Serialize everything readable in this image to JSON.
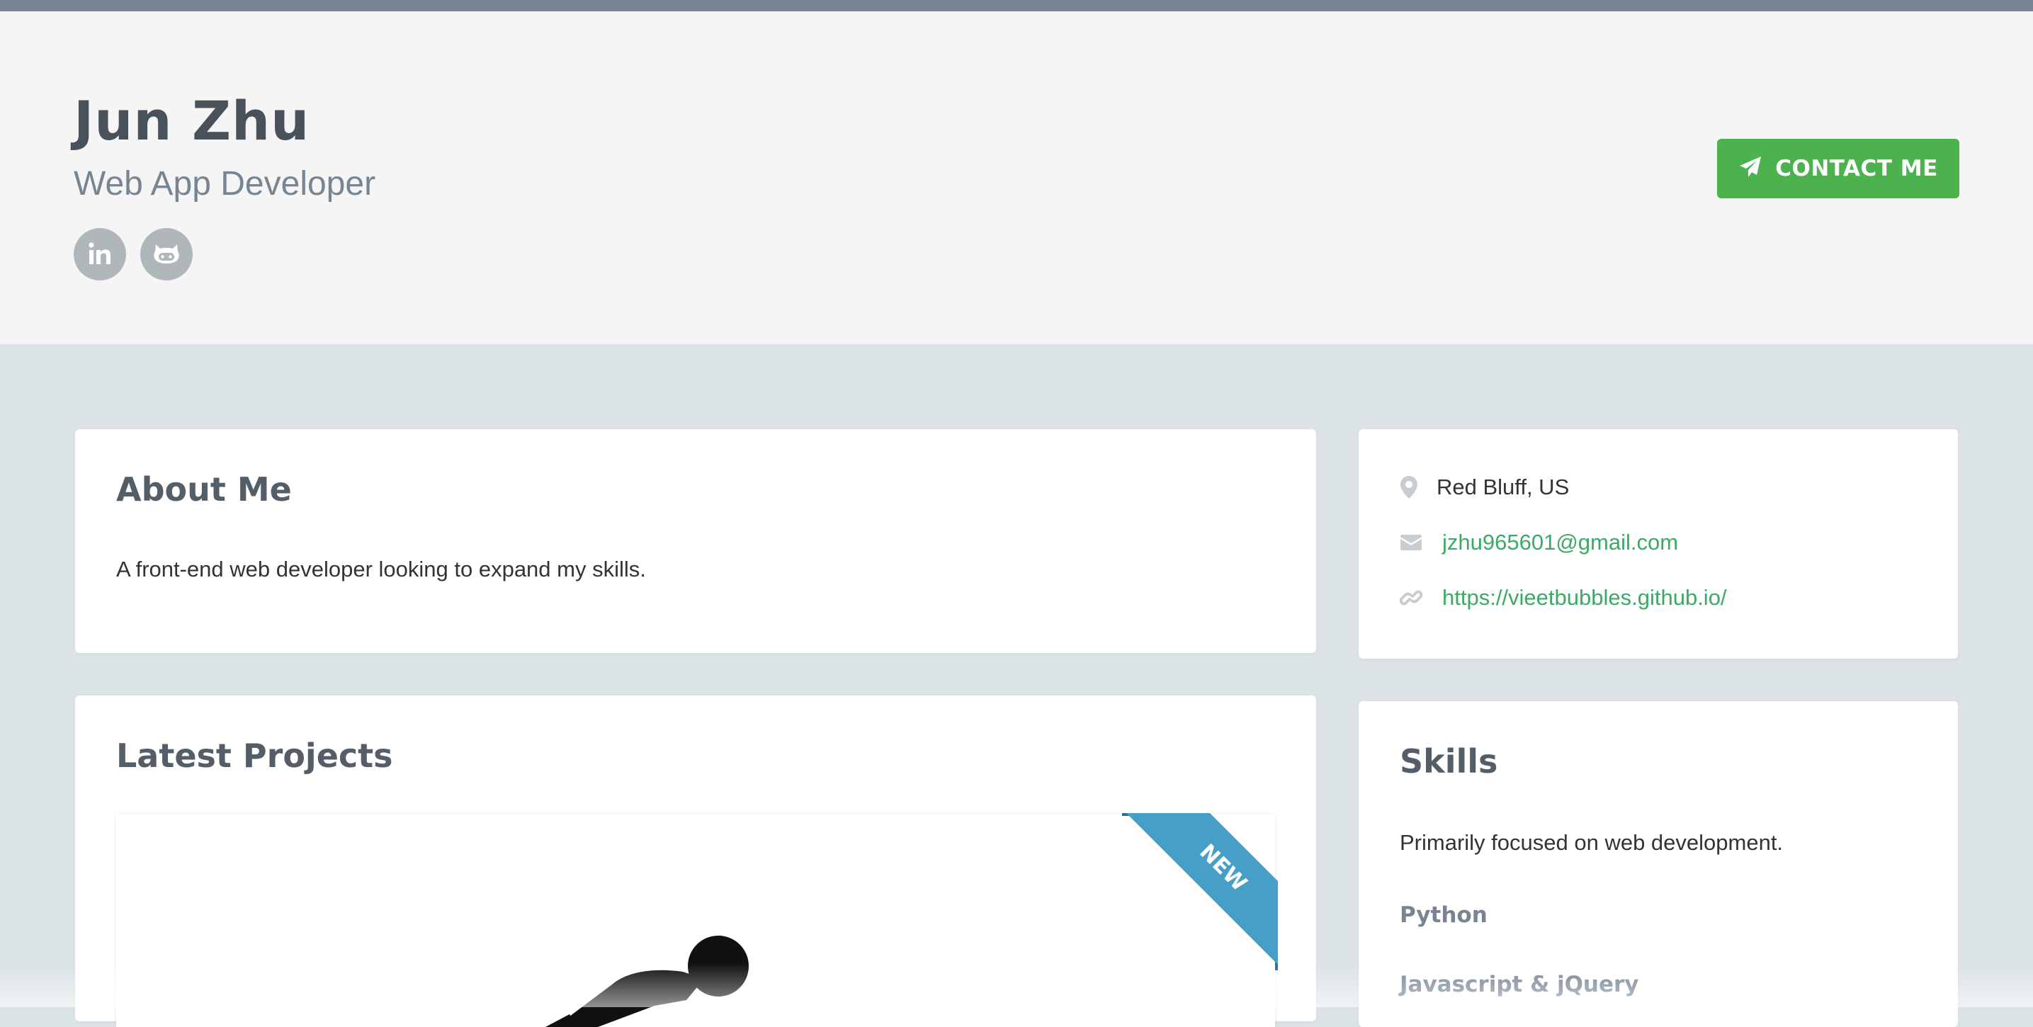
{
  "profile": {
    "name": "Jun Zhu",
    "tagline": "Web App Developer",
    "contact_label": "CONTACT ME"
  },
  "social": [
    {
      "name": "linkedin",
      "icon": "linkedin-icon"
    },
    {
      "name": "github",
      "icon": "github-icon"
    }
  ],
  "about": {
    "title": "About Me",
    "text": "A front-end web developer looking to expand my skills."
  },
  "info": {
    "location": "Red Bluff, US",
    "email": "jzhu965601@gmail.com",
    "website": "https://vieetbubbles.github.io/"
  },
  "projects": {
    "title": "Latest Projects",
    "ribbon": "NEW"
  },
  "skills": {
    "title": "Skills",
    "intro": "Primarily focused on web development.",
    "items": [
      "Python",
      "Javascript & jQuery"
    ]
  },
  "colors": {
    "accent_green": "#4cb24d",
    "link_green": "#3aaa64",
    "ribbon_blue": "#479fc8",
    "heading": "#545e69",
    "muted": "#778492"
  }
}
